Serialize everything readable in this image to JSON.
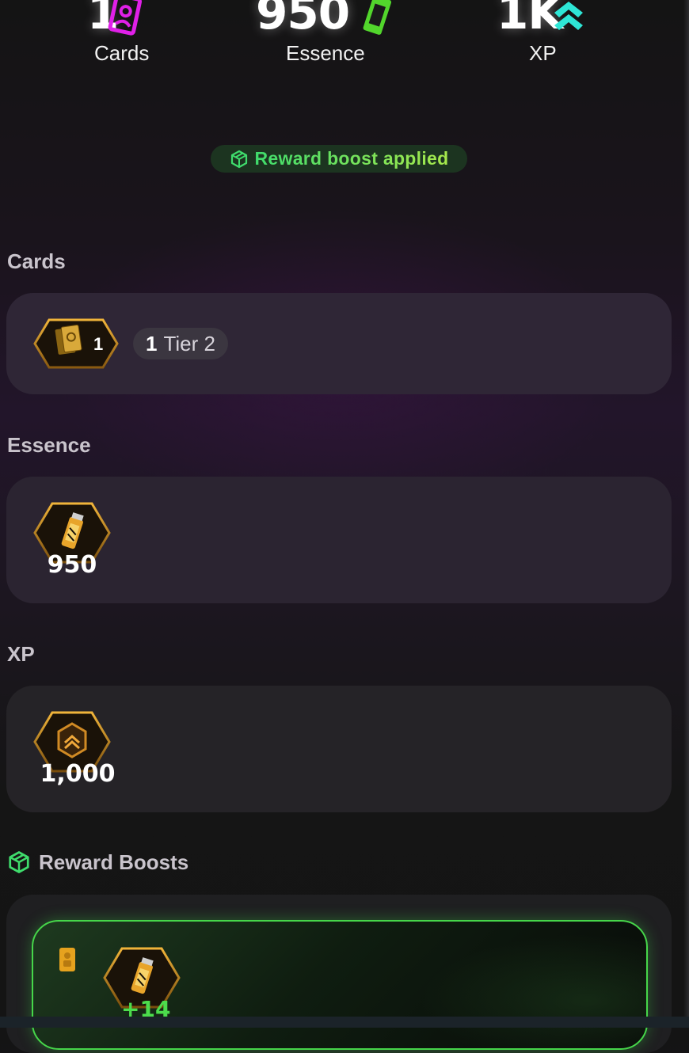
{
  "stats": [
    {
      "value": "1",
      "label": "Cards",
      "icon": "card-icon",
      "color": "#e020e8"
    },
    {
      "value": "950",
      "label": "Essence",
      "icon": "essence-vial-icon",
      "color": "#52d62c"
    },
    {
      "value": "1K",
      "label": "XP",
      "icon": "xp-chevrons-icon",
      "color": "#2ee6d6"
    }
  ],
  "boost_banner": {
    "label": "Reward boost applied",
    "icon": "boost-cube-icon"
  },
  "sections": {
    "cards": {
      "title": "Cards",
      "item": {
        "icon": "gold-card-icon",
        "count": "1",
        "tier_count": "1",
        "tier_label": "Tier 2"
      }
    },
    "essence": {
      "title": "Essence",
      "item": {
        "icon": "essence-bottle-icon",
        "value": "950"
      }
    },
    "xp": {
      "title": "XP",
      "item": {
        "icon": "xp-badge-icon",
        "value": "1,000"
      }
    },
    "reward_boosts": {
      "title": "Reward Boosts",
      "icon": "boost-cube-icon",
      "item": {
        "icon": "essence-bottle-icon",
        "value": "+14",
        "tag_icon": "card-tag-icon"
      }
    }
  },
  "colors": {
    "accent_green": "#46d64a",
    "panel": "#2c2333",
    "gold": "#c98a1a"
  }
}
